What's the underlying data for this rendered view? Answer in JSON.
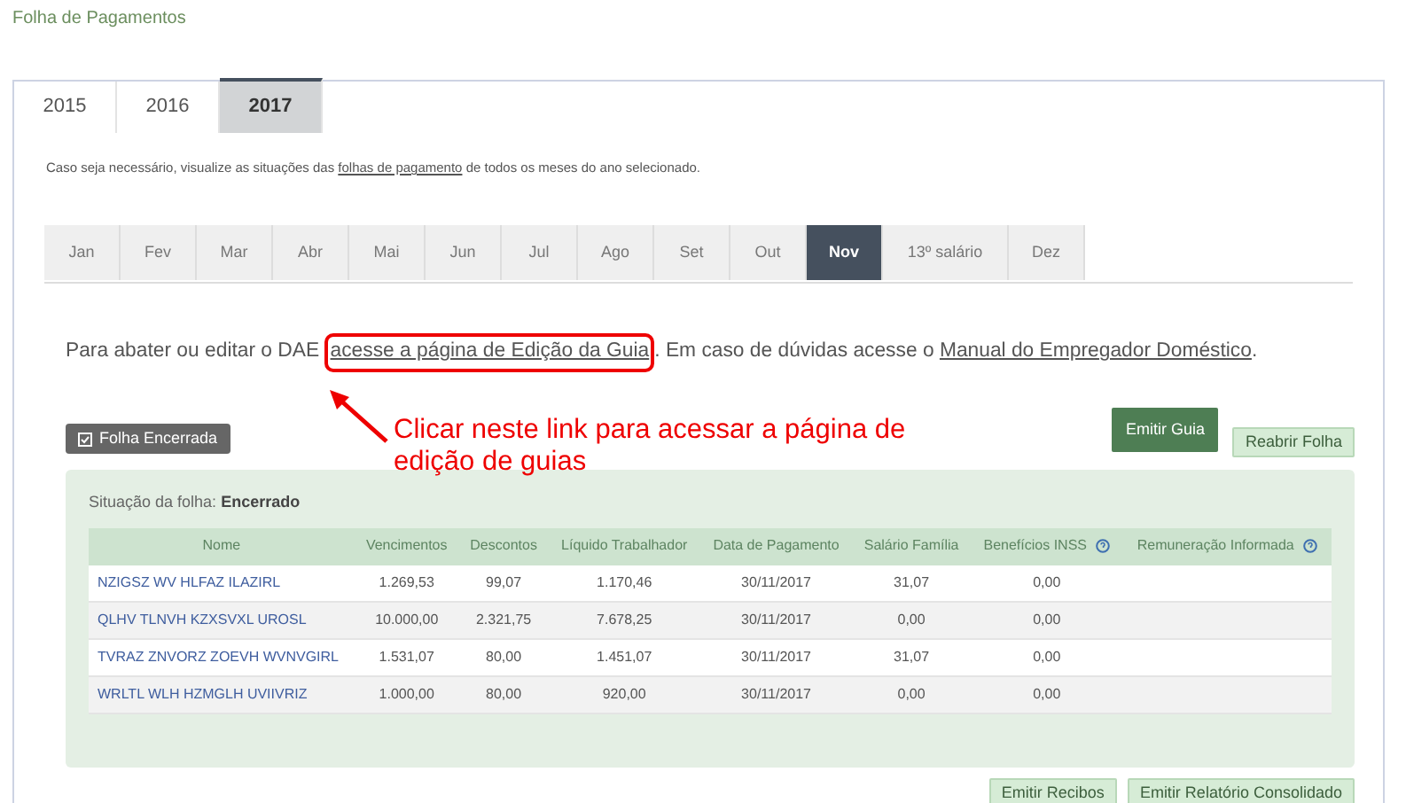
{
  "page_title": "Folha de Pagamentos",
  "year_tabs": [
    {
      "label": "2015",
      "selected": false
    },
    {
      "label": "2016",
      "selected": false
    },
    {
      "label": "2017",
      "selected": true
    }
  ],
  "help_text": {
    "before": "Caso seja necessário, visualize as situações das ",
    "link": "folhas de pagamento",
    "after": " de todos os meses do ano selecionado."
  },
  "month_tabs": [
    {
      "label": "Jan",
      "selected": false
    },
    {
      "label": "Fev",
      "selected": false
    },
    {
      "label": "Mar",
      "selected": false
    },
    {
      "label": "Abr",
      "selected": false
    },
    {
      "label": "Mai",
      "selected": false
    },
    {
      "label": "Jun",
      "selected": false
    },
    {
      "label": "Jul",
      "selected": false
    },
    {
      "label": "Ago",
      "selected": false
    },
    {
      "label": "Set",
      "selected": false
    },
    {
      "label": "Out",
      "selected": false
    },
    {
      "label": "Nov",
      "selected": true
    },
    {
      "label": "13º salário",
      "selected": false
    },
    {
      "label": "Dez",
      "selected": false
    }
  ],
  "info_text": {
    "before": "Para abater ou editar o DAE ",
    "link": "acesse a página de Edição da Guia",
    "middle": ". Em caso de dúvidas acesse o ",
    "link2": "Manual do Empregador Doméstico",
    "after": "."
  },
  "status_badge": "Folha Encerrada",
  "buttons_top": [
    "Emitir Guia",
    "Reabrir Folha"
  ],
  "annotation": {
    "text": "Clicar neste link para acessar a página de edição de guias"
  },
  "sheet": {
    "status_label": "Situação da folha:",
    "status_value": "Encerrado",
    "table": {
      "columns": [
        {
          "label": "Nome",
          "help": false
        },
        {
          "label": "Vencimentos",
          "help": false
        },
        {
          "label": "Descontos",
          "help": false
        },
        {
          "label": "Líquido Trabalhador",
          "help": false
        },
        {
          "label": "Data de Pagamento",
          "help": false
        },
        {
          "label": "Salário Família",
          "help": false
        },
        {
          "label": "Benefícios INSS",
          "help": true
        },
        {
          "label": "Remuneração Informada",
          "help": true
        }
      ],
      "rows": [
        [
          "NZIGSZ WV HLFAZ ILAZIRL",
          "1.269,53",
          "99,07",
          "1.170,46",
          "30/11/2017",
          "31,07",
          "0,00",
          ""
        ],
        [
          "QLHV TLNVH KZXSVXL UROSL",
          "10.000,00",
          "2.321,75",
          "7.678,25",
          "30/11/2017",
          "0,00",
          "0,00",
          ""
        ],
        [
          "TVRAZ ZNVORZ ZOEVH WVNVGIRL",
          "1.531,07",
          "80,00",
          "1.451,07",
          "30/11/2017",
          "31,07",
          "0,00",
          ""
        ],
        [
          "WRLTL WLH HZMGLH UVIIVRIZ",
          "1.000,00",
          "80,00",
          "920,00",
          "30/11/2017",
          "0,00",
          "0,00",
          ""
        ]
      ]
    }
  },
  "buttons_bottom": [
    "Emitir Recibos",
    "Emitir Relatório Consolidado"
  ]
}
